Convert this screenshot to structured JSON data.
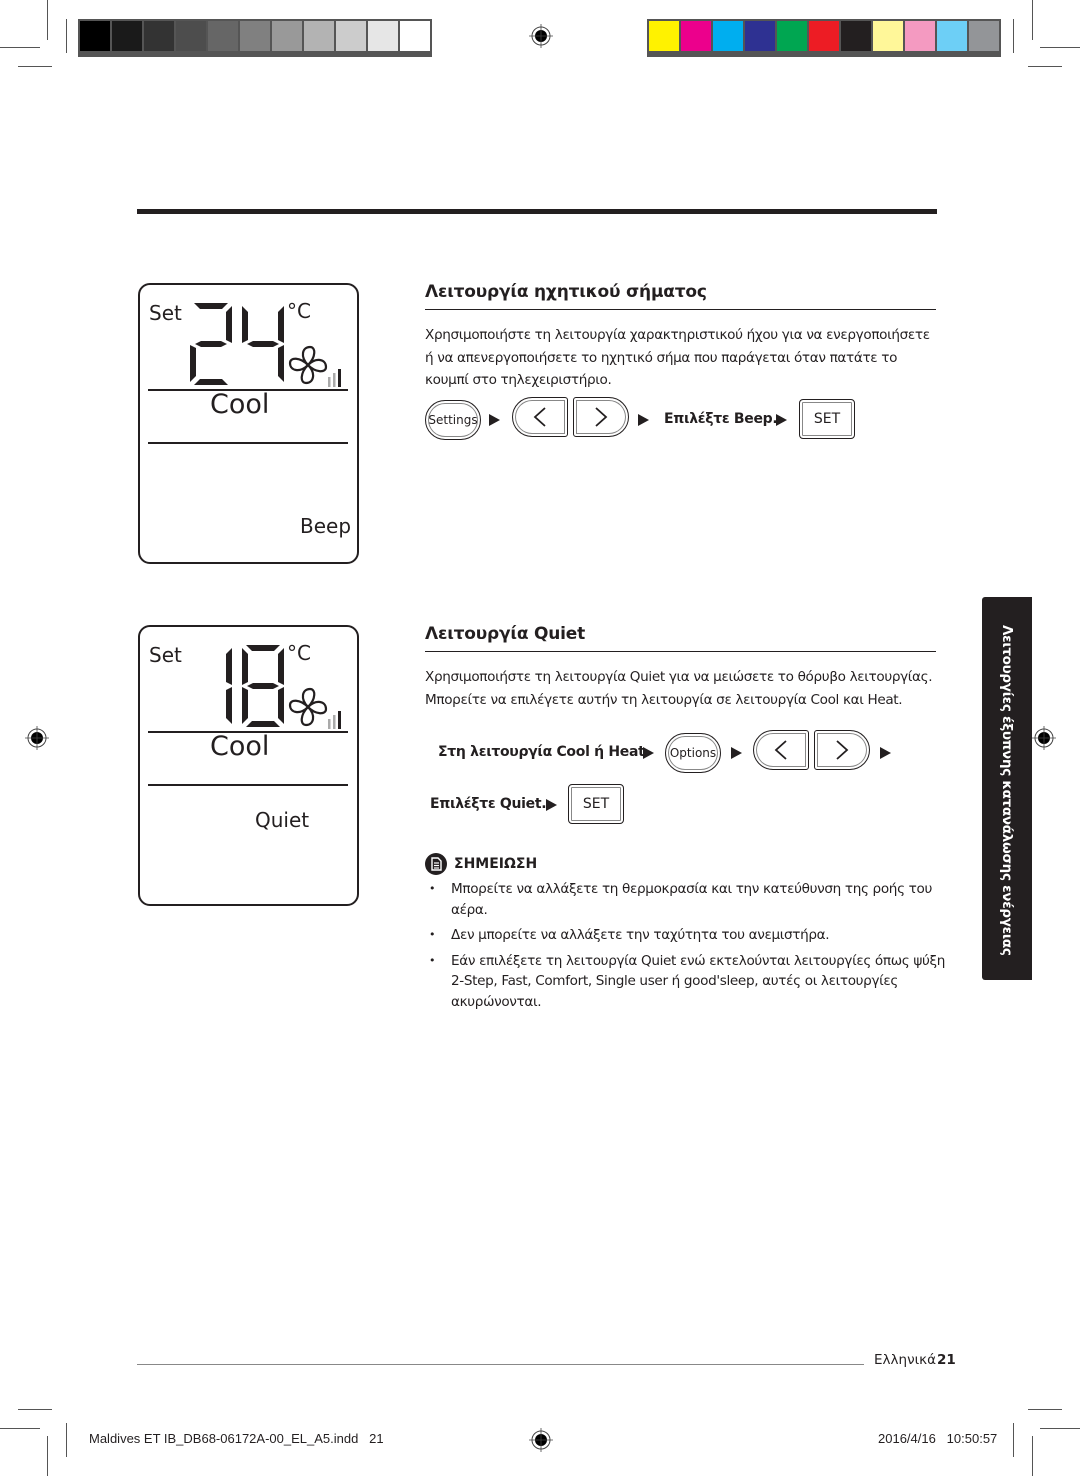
{
  "print_marks": {
    "gray_swatches": [
      "#000000",
      "#1a1a1a",
      "#333333",
      "#4d4d4d",
      "#666666",
      "#808080",
      "#999999",
      "#b3b3b3",
      "#cccccc",
      "#e6e6e6",
      "#ffffff"
    ],
    "color_swatches": [
      "#fff200",
      "#ec008c",
      "#00aeef",
      "#2e3192",
      "#00a651",
      "#ed1c24",
      "#231f20",
      "#fff799",
      "#f49ac1",
      "#6dcff6",
      "#939598"
    ]
  },
  "panels": [
    {
      "set_label": "Set",
      "temperature": "24",
      "unit": "°C",
      "mode": "Cool",
      "function_label": "Beep",
      "fan_level": 3
    },
    {
      "set_label": "Set",
      "temperature": "18",
      "unit": "°C",
      "mode": "Cool",
      "function_label": "Quiet",
      "fan_level": 3
    }
  ],
  "beep_section": {
    "title": "Λειτουργία ηχητικού σήματος",
    "description": "Χρησιμοποιήστε τη λειτουργία χαρακτηριστικού ήχου για να ενεργοποιήσετε ή να απενεργοποιήσετε το ηχητικό σήμα που παράγεται όταν πατάτε το κουμπί στο τηλεχειριστήριο.",
    "steps": {
      "settings_button": "Settings",
      "select_text": "Επιλέξτε Beep.",
      "set_button": "SET"
    }
  },
  "quiet_section": {
    "title": "Λειτουργία Quiet",
    "description": "Χρησιμοποιήστε τη λειτουργία Quiet για να μειώσετε το θόρυβο λειτουργίας. Μπορείτε να επιλέγετε αυτήν τη λειτουργία σε λειτουργία Cool και Heat.",
    "steps": {
      "condition_text": "Στη λειτουργία Cool ή Heat",
      "options_button": "Options",
      "select_text": "Επιλέξτε Quiet.",
      "set_button": "SET"
    },
    "note": {
      "title": "ΣΗΜΕΙΩΣΗ",
      "items": [
        "Μπορείτε να αλλάξετε τη θερμοκρασία και την κατεύθυνση της ροής του αέρα.",
        "Δεν μπορείτε να αλλάξετε την ταχύτητα του ανεμιστήρα.",
        "Εάν επιλέξετε τη λειτουργία Quiet ενώ εκτελούνται λειτουργίες όπως ψύξη 2-Step, Fast, Comfort, Single user ή good'sleep, αυτές οι λειτουργίες ακυρώνονται."
      ]
    }
  },
  "side_tab": "Λειτουργίες έξυπνης κατανάλωσης ενέργειας",
  "footer": {
    "language": "Ελληνικά",
    "page_number": "21",
    "slug_file": "Maldives ET IB_DB68-06172A-00_EL_A5.indd   21",
    "slug_date": "2016/4/16   10:50:57"
  }
}
